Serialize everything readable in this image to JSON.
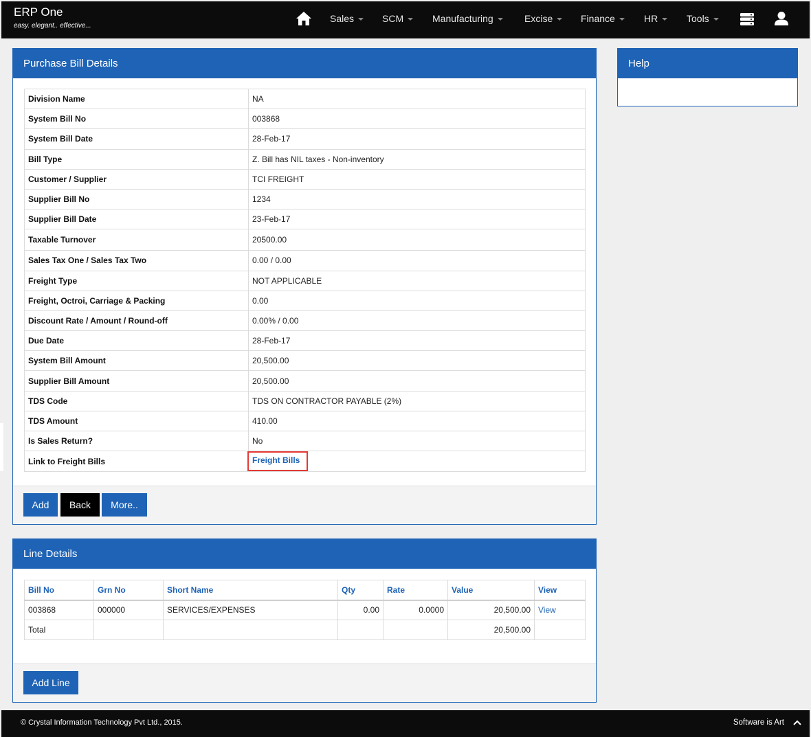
{
  "brand": {
    "title": "ERP One",
    "tagline": "easy. elegant.. effective..."
  },
  "nav": {
    "items": [
      "Sales",
      "SCM",
      "Manufacturing",
      "Excise",
      "Finance",
      "HR",
      "Tools"
    ],
    "icons": [
      "home-icon",
      "database-icon",
      "user-icon"
    ]
  },
  "bill": {
    "title": "Purchase Bill Details",
    "rows": [
      {
        "label": "Division Name",
        "value": "NA"
      },
      {
        "label": "System Bill No",
        "value": "003868"
      },
      {
        "label": "System Bill Date",
        "value": "28-Feb-17"
      },
      {
        "label": "Bill Type",
        "value": "Z. Bill has NIL taxes - Non-inventory"
      },
      {
        "label": "Customer / Supplier",
        "value": "TCI FREIGHT"
      },
      {
        "label": "Supplier Bill No",
        "value": "1234"
      },
      {
        "label": "Supplier Bill Date",
        "value": "23-Feb-17"
      },
      {
        "label": "Taxable Turnover",
        "value": "20500.00"
      },
      {
        "label": "Sales Tax One / Sales Tax Two",
        "value": "0.00 / 0.00"
      },
      {
        "label": "Freight Type",
        "value": "NOT APPLICABLE"
      },
      {
        "label": "Freight, Octroi, Carriage & Packing",
        "value": "0.00"
      },
      {
        "label": "Discount Rate / Amount / Round-off",
        "value": "0.00% / 0.00"
      },
      {
        "label": "Due Date",
        "value": "28-Feb-17"
      },
      {
        "label": "System Bill Amount",
        "value": "20,500.00"
      },
      {
        "label": "Supplier Bill Amount",
        "value": "20,500.00"
      },
      {
        "label": "TDS Code",
        "value": "TDS ON CONTRACTOR PAYABLE (2%)"
      },
      {
        "label": "TDS Amount",
        "value": "410.00"
      },
      {
        "label": "Is Sales Return?",
        "value": "No"
      }
    ],
    "freight_label": "Link to Freight Bills",
    "freight_link": "Freight Bills",
    "buttons": {
      "add": "Add",
      "back": "Back",
      "more": "More.."
    }
  },
  "help": {
    "title": "Help"
  },
  "lines": {
    "title": "Line Details",
    "headers": [
      "Bill No",
      "Grn No",
      "Short Name",
      "Qty",
      "Rate",
      "Value",
      "View"
    ],
    "row": {
      "bill_no": "003868",
      "grn_no": "000000",
      "short_name": "SERVICES/EXPENSES",
      "qty": "0.00",
      "rate": "0.0000",
      "value": "20,500.00",
      "view": "View"
    },
    "total": {
      "label": "Total",
      "value": "20,500.00"
    },
    "add_line": "Add Line"
  },
  "footer": {
    "copyright": "© Crystal Information Technology Pvt Ltd., 2015.",
    "tagline": "Software is Art"
  }
}
